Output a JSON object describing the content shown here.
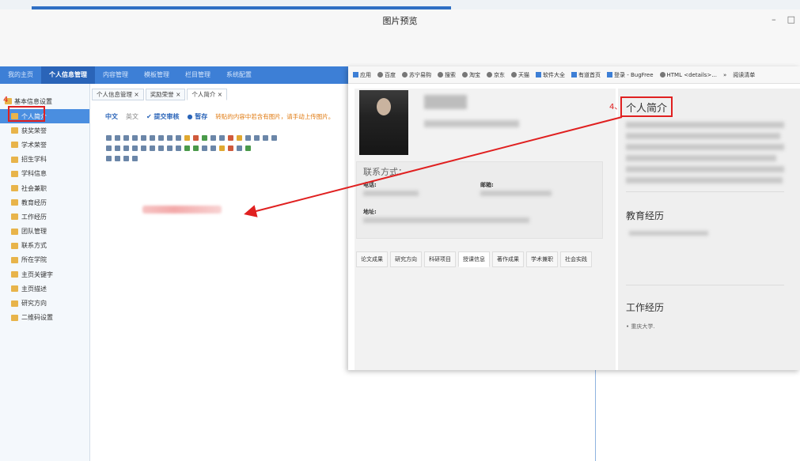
{
  "window": {
    "title": "图片预览",
    "controls": [
      "–",
      "□"
    ]
  },
  "navbar": {
    "items": [
      {
        "label": "我的主页"
      },
      {
        "label": "个人信息管理"
      },
      {
        "label": "内容管理"
      },
      {
        "label": "模板管理"
      },
      {
        "label": "栏目管理"
      },
      {
        "label": "系统配置"
      }
    ],
    "active_index": 1
  },
  "sidebar": {
    "group_label": "基本信息设置",
    "items": [
      {
        "label": "个人简介"
      },
      {
        "label": "获奖荣誉"
      },
      {
        "label": "学术荣誉"
      },
      {
        "label": "招生学科"
      },
      {
        "label": "学科信息"
      },
      {
        "label": "社会兼职"
      },
      {
        "label": "教育经历"
      },
      {
        "label": "工作经历"
      },
      {
        "label": "团队管理"
      },
      {
        "label": "联系方式"
      },
      {
        "label": "所在学院"
      },
      {
        "label": "主页关键字"
      },
      {
        "label": "主页描述"
      },
      {
        "label": "研究方向"
      },
      {
        "label": "二维码设置"
      }
    ],
    "active_index": 0,
    "step_label": "4"
  },
  "editor": {
    "tabs": [
      {
        "label": "个人信息管理",
        "close": "×"
      },
      {
        "label": "奖励荣誉",
        "close": "×"
      },
      {
        "label": "个人简介",
        "close": "×"
      }
    ],
    "lang_zh": "中文",
    "lang_en": "英文",
    "submit_label": "✔ 提交审核",
    "save_label": "● 暂存",
    "warning": "转贴的内容中若含有图片，请手动上传图片。"
  },
  "preview": {
    "bookmarks": [
      "应用",
      "百度",
      "苏宁易购",
      "搜索",
      "淘宝",
      "京东",
      "天猫",
      "软件大全",
      "有道首页",
      "登录 - BugFree",
      "HTML <details>..."
    ],
    "bookmarks_more": "»",
    "bookmarks_reading": "阅读清单",
    "contact_title": "联系方式：",
    "phone_label": "电话:",
    "email_label": "邮箱:",
    "address_label": "地址:",
    "tabs": [
      "论文成果",
      "研究方向",
      "科研项目",
      "授课信息",
      "著作成果",
      "学术兼职",
      "社会实践"
    ],
    "active_tab_index": 3,
    "right": {
      "step_label": "4、",
      "intro_title": "个人简介",
      "education_title": "教育经历",
      "work_title": "工作经历",
      "work_item": "• 重庆大学."
    }
  },
  "colors": {
    "nav_blue": "#3d7fd6",
    "annotation_red": "#e02020",
    "sidebar_active": "#4a8ee0"
  }
}
